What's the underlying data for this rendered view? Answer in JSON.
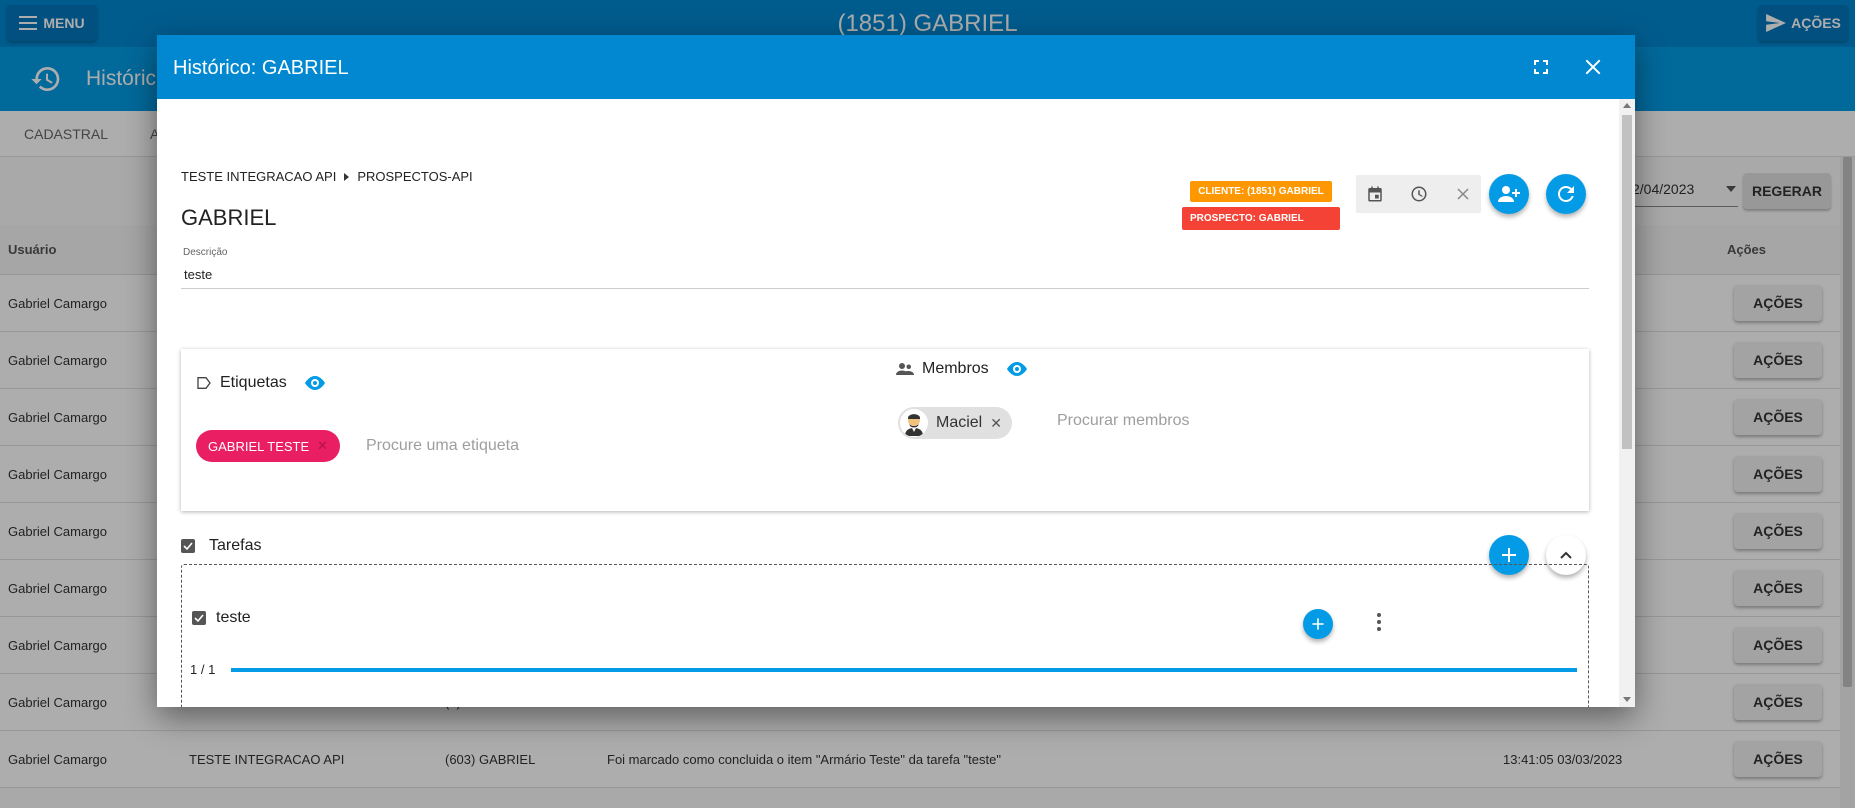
{
  "topbar": {
    "title": "(1851) GABRIEL",
    "menu_label": "MENU",
    "actions_label": "AÇÕES"
  },
  "subheader": {
    "title": "Históric"
  },
  "tabs": [
    {
      "label": "CADASTRAL"
    },
    {
      "label": "A"
    }
  ],
  "filters": {
    "date_value": "2/04/2023",
    "regerar_label": "REGERAR"
  },
  "table": {
    "headers": {
      "usuario": "Usuário",
      "acoes": "Ações"
    },
    "row_button_label": "AÇÕES",
    "rows": [
      {
        "usuario": "Gabriel Camargo",
        "integracao": "",
        "prospecto": "",
        "mensagem": "",
        "data": ""
      },
      {
        "usuario": "Gabriel Camargo",
        "integracao": "",
        "prospecto": "",
        "mensagem": "",
        "data": ""
      },
      {
        "usuario": "Gabriel Camargo",
        "integracao": "",
        "prospecto": "",
        "mensagem": "",
        "data": ""
      },
      {
        "usuario": "Gabriel Camargo",
        "integracao": "",
        "prospecto": "",
        "mensagem": "",
        "data": ""
      },
      {
        "usuario": "Gabriel Camargo",
        "integracao": "",
        "prospecto": "",
        "mensagem": "",
        "data": ""
      },
      {
        "usuario": "Gabriel Camargo",
        "integracao": "",
        "prospecto": "",
        "mensagem": "",
        "data": ""
      },
      {
        "usuario": "Gabriel Camargo",
        "integracao": "",
        "prospecto": "",
        "mensagem": "",
        "data": ""
      },
      {
        "usuario": "Gabriel Camargo",
        "integracao": "",
        "prospecto": "(..)",
        "mensagem": "",
        "data": ""
      },
      {
        "usuario": "Gabriel Camargo",
        "integracao": "TESTE INTEGRACAO API",
        "prospecto": "(603) GABRIEL",
        "mensagem": "Foi marcado como concluida o item \"Armário Teste\" da tarefa \"teste\"",
        "data": "13:41:05 03/03/2023"
      }
    ]
  },
  "dialog": {
    "title": "Histórico: GABRIEL",
    "breadcrumb": {
      "first": "TESTE INTEGRACAO API",
      "second": "PROSPECTOS-API"
    },
    "card_title": "GABRIEL",
    "description": {
      "label": "Descrição",
      "value": "teste"
    },
    "badges": {
      "cliente": "CLIENTE: (1851) GABRIEL",
      "prospecto": "PROSPECTO: GABRIEL"
    },
    "labels": {
      "heading": "Etiquetas",
      "chip": "GABRIEL TESTE",
      "search_placeholder": "Procure uma etiqueta"
    },
    "members": {
      "heading": "Membros",
      "chip": "Maciel",
      "search_placeholder": "Procurar membros"
    },
    "tasks": {
      "heading": "Tarefas",
      "items": [
        {
          "name": "teste",
          "count": "1 / 1",
          "progress": 1.0
        }
      ]
    },
    "colors": {
      "primary": "#0288d1",
      "accent": "#039be5",
      "tag": "#e91e63",
      "cliente_badge": "#ff9800",
      "prospecto_badge": "#f44336"
    }
  }
}
